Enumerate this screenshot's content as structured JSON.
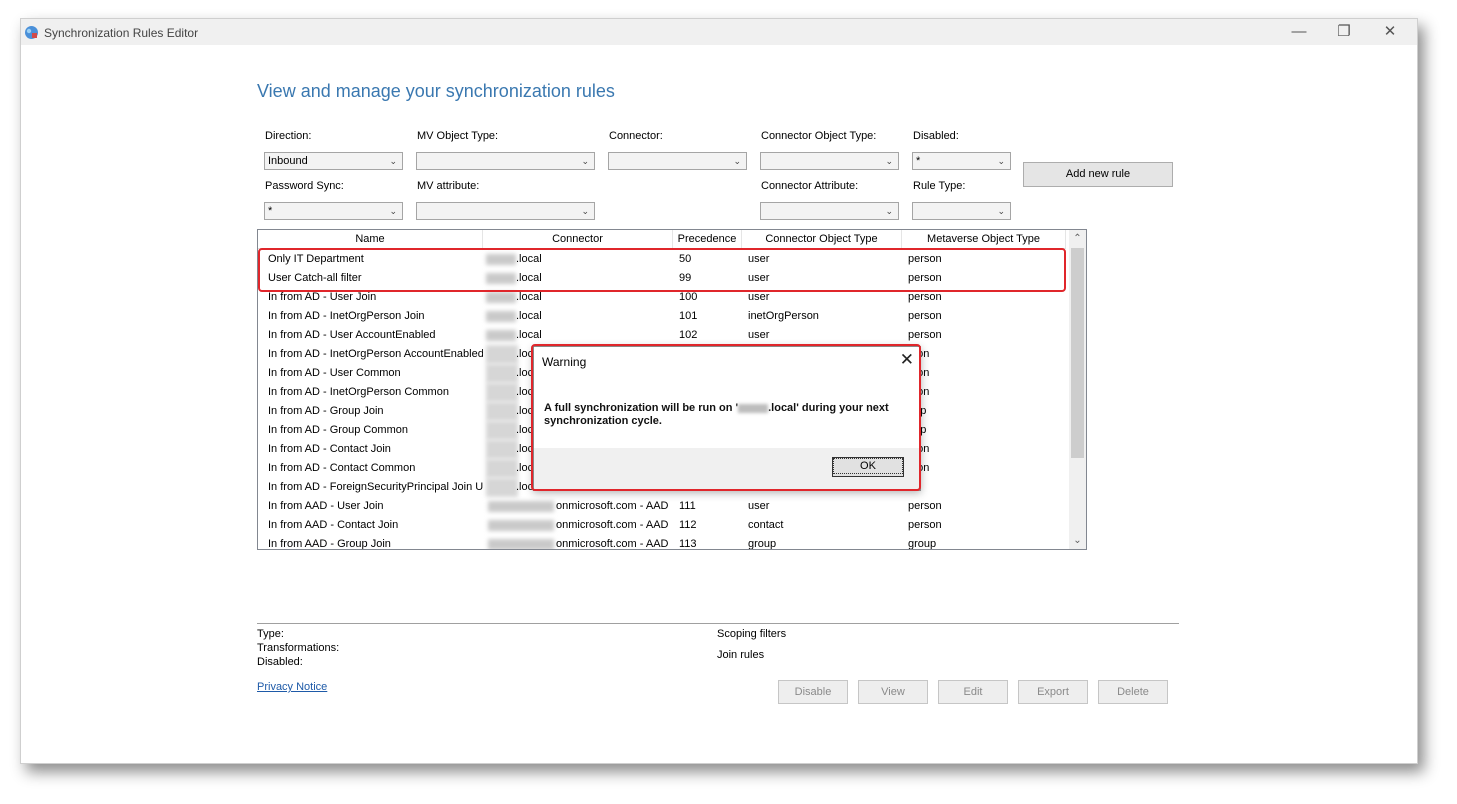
{
  "window": {
    "title": "Synchronization Rules Editor"
  },
  "page_title": "View and manage your synchronization rules",
  "filters": {
    "direction": {
      "label": "Direction:",
      "value": "Inbound"
    },
    "mv_object_type": {
      "label": "MV Object Type:",
      "value": ""
    },
    "connector": {
      "label": "Connector:",
      "value": ""
    },
    "connector_object_type": {
      "label": "Connector Object Type:",
      "value": ""
    },
    "disabled": {
      "label": "Disabled:",
      "value": "*"
    },
    "password_sync": {
      "label": "Password Sync:",
      "value": "*"
    },
    "mv_attribute": {
      "label": "MV attribute:",
      "value": ""
    },
    "connector_attribute": {
      "label": "Connector Attribute:",
      "value": ""
    },
    "rule_type": {
      "label": "Rule Type:",
      "value": ""
    }
  },
  "add_rule_label": "Add new rule",
  "grid": {
    "columns": [
      "Name",
      "Connector",
      "Precedence",
      "Connector Object Type",
      "Metaverse Object Type"
    ],
    "rows": [
      [
        "Only IT Department",
        ".local",
        "50",
        "user",
        "person"
      ],
      [
        "User Catch-all filter",
        ".local",
        "99",
        "user",
        "person"
      ],
      [
        "In from AD - User Join",
        ".local",
        "100",
        "user",
        "person"
      ],
      [
        "In from AD - InetOrgPerson Join",
        ".local",
        "101",
        "inetOrgPerson",
        "person"
      ],
      [
        "In from AD - User AccountEnabled",
        ".local",
        "102",
        "user",
        "person"
      ],
      [
        "In from AD - InetOrgPerson AccountEnabled",
        ".loc",
        "",
        "",
        "rson"
      ],
      [
        "In from AD - User Common",
        ".loc",
        "",
        "",
        "rson"
      ],
      [
        "In from AD - InetOrgPerson Common",
        ".loc",
        "",
        "",
        "rson"
      ],
      [
        "In from AD - Group Join",
        ".loc",
        "",
        "",
        "oup"
      ],
      [
        "In from AD - Group Common",
        ".loc",
        "",
        "",
        "oup"
      ],
      [
        "In from AD - Contact Join",
        ".loc",
        "",
        "",
        "rson"
      ],
      [
        "In from AD - Contact Common",
        ".loc",
        "",
        "",
        "rson"
      ],
      [
        "In from AD - ForeignSecurityPrincipal Join Us",
        ".loc",
        "",
        "",
        ""
      ],
      [
        "In from AAD - User Join",
        "onmicrosoft.com - AAD",
        "111",
        "user",
        "person"
      ],
      [
        "In from AAD - Contact Join",
        "onmicrosoft.com - AAD",
        "112",
        "contact",
        "person"
      ],
      [
        "In from AAD - Group Join",
        "onmicrosoft.com - AAD",
        "113",
        "group",
        "group"
      ]
    ]
  },
  "dialog": {
    "title": "Warning",
    "message_before": "A full synchronization will be run on '",
    "message_after": ".local' during your next synchronization cycle.",
    "ok_label": "OK"
  },
  "details": {
    "type_label": "Type:",
    "transformations_label": "Transformations:",
    "disabled_label": "Disabled:",
    "scoping_label": "Scoping filters",
    "join_label": "Join rules"
  },
  "privacy_label": "Privacy Notice",
  "actions": {
    "disable": "Disable",
    "view": "View",
    "edit": "Edit",
    "export": "Export",
    "delete": "Delete"
  },
  "colors": {
    "title_blue": "#3a78b0",
    "highlight_red": "#e0262b",
    "link_blue": "#1e5aa8"
  }
}
